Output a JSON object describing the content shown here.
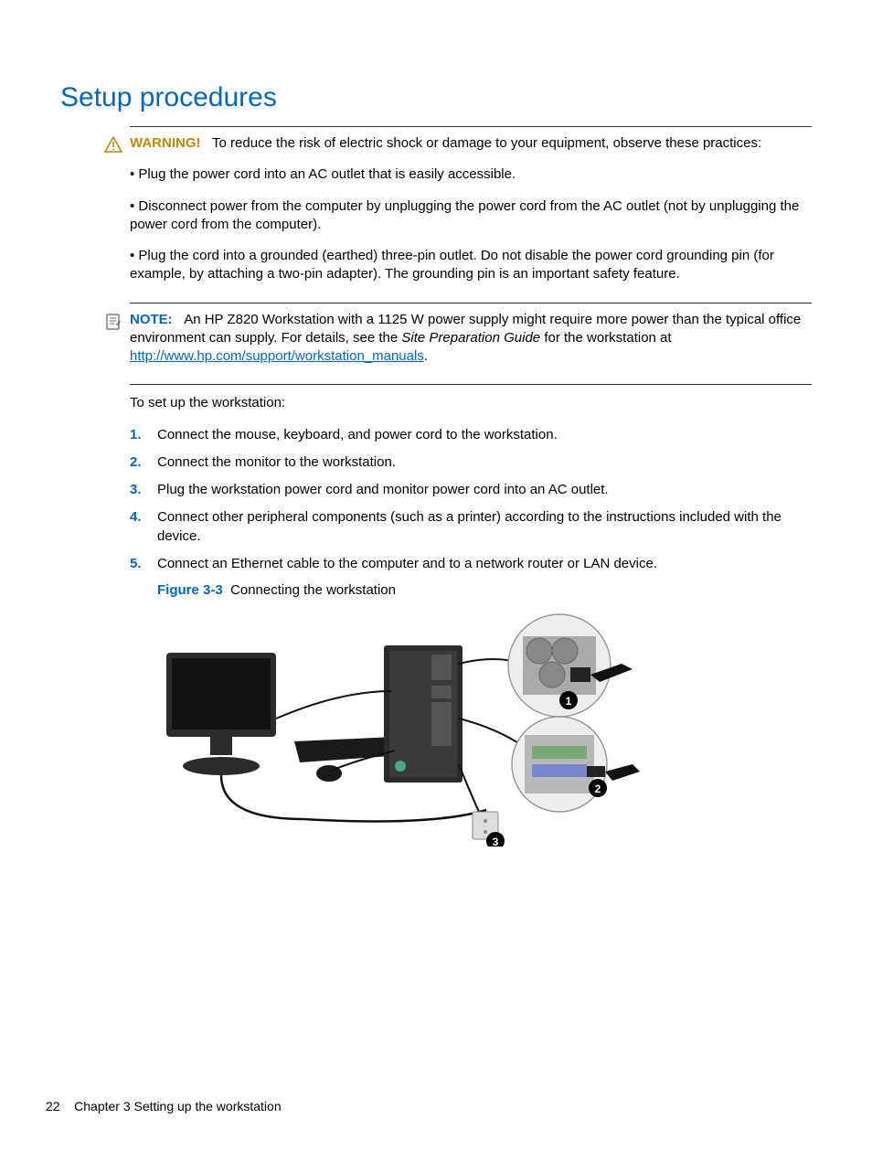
{
  "section_title": "Setup procedures",
  "warning": {
    "label": "WARNING!",
    "intro": "To reduce the risk of electric shock or damage to your equipment, observe these practices:",
    "bullets": [
      "• Plug the power cord into an AC outlet that is easily accessible.",
      "• Disconnect power from the computer by unplugging the power cord from the AC outlet (not by unplugging the power cord from the computer).",
      "• Plug the cord into a grounded (earthed) three-pin outlet. Do not disable the power cord grounding pin (for example, by attaching a two-pin adapter). The grounding pin is an important safety feature."
    ]
  },
  "note": {
    "label": "NOTE:",
    "text_before_italic": "An HP Z820 Workstation with a 1125 W power supply might require more power than the typical office environment can supply. For details, see the ",
    "italic": "Site Preparation Guide",
    "text_after_italic": " for the workstation at ",
    "link": "http://www.hp.com/support/workstation_manuals",
    "period": "."
  },
  "setup_intro": "To set up the workstation:",
  "steps": [
    {
      "num": "1.",
      "text": "Connect the mouse, keyboard, and power cord to the workstation."
    },
    {
      "num": "2.",
      "text": "Connect the monitor to the workstation."
    },
    {
      "num": "3.",
      "text": "Plug the workstation power cord and monitor power cord into an AC outlet."
    },
    {
      "num": "4.",
      "text": "Connect other peripheral components (such as a printer) according to the instructions included with the device."
    },
    {
      "num": "5.",
      "text": "Connect an Ethernet cable to the computer and to a network router or LAN device."
    }
  ],
  "figure": {
    "label": "Figure 3-3",
    "caption": "Connecting the workstation",
    "callouts": [
      "1",
      "2",
      "3"
    ]
  },
  "footer": {
    "page_number": "22",
    "chapter": "Chapter 3   Setting up the workstation"
  }
}
